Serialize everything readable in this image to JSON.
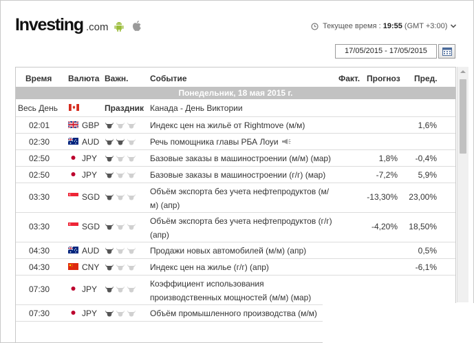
{
  "header": {
    "logo": "Investing",
    "logo_suffix": ".com",
    "time_label": "Текущее время :",
    "time_value": "19:55",
    "timezone": "(GMT +3:00)",
    "date_range": "17/05/2015 - 17/05/2015"
  },
  "columns": {
    "time": "Время",
    "currency": "Валюта",
    "importance": "Важн.",
    "event": "Событие",
    "actual": "Факт.",
    "forecast": "Прогноз",
    "previous": "Пред."
  },
  "day_header": "Понедельник, 18 мая 2015 г.",
  "holiday": {
    "time": "Весь День",
    "flag": "CA",
    "importance": "Праздник",
    "event": "Канада - День Виктории"
  },
  "rows": [
    {
      "time": "02:01",
      "flag": "GB",
      "currency": "GBP",
      "importance": 1,
      "event": "Индекс цен на жильё от Rightmove (м/м)",
      "actual": "",
      "forecast": "",
      "previous": "1,6%",
      "speech": false
    },
    {
      "time": "02:30",
      "flag": "AU",
      "currency": "AUD",
      "importance": 2,
      "event": "Речь помощника главы РБА Лоуи",
      "actual": "",
      "forecast": "",
      "previous": "",
      "speech": true
    },
    {
      "time": "02:50",
      "flag": "JP",
      "currency": "JPY",
      "importance": 1,
      "event": "Базовые заказы в машиностроении (м/м) (мар)",
      "actual": "",
      "forecast": "1,8%",
      "previous": "-0,4%",
      "speech": false
    },
    {
      "time": "02:50",
      "flag": "JP",
      "currency": "JPY",
      "importance": 1,
      "event": "Базовые заказы в машиностроении (г/г) (мар)",
      "actual": "",
      "forecast": "-7,2%",
      "previous": "5,9%",
      "speech": false
    },
    {
      "time": "03:30",
      "flag": "SG",
      "currency": "SGD",
      "importance": 1,
      "event": "Объём экспорта без учета нефтепродуктов (м/м) (апр)",
      "actual": "",
      "forecast": "-13,30%",
      "previous": "23,00%",
      "speech": false
    },
    {
      "time": "03:30",
      "flag": "SG",
      "currency": "SGD",
      "importance": 1,
      "event": "Объём экспорта без учета нефтепродуктов (г/г) (апр)",
      "actual": "",
      "forecast": "-4,20%",
      "previous": "18,50%",
      "speech": false
    },
    {
      "time": "04:30",
      "flag": "AU",
      "currency": "AUD",
      "importance": 1,
      "event": "Продажи новых автомобилей (м/м) (апр)",
      "actual": "",
      "forecast": "",
      "previous": "0,5%",
      "speech": false
    },
    {
      "time": "04:30",
      "flag": "CN",
      "currency": "CNY",
      "importance": 1,
      "event": "Индекс цен на жилье (г/г) (апр)",
      "actual": "",
      "forecast": "",
      "previous": "-6,1%",
      "speech": false
    },
    {
      "time": "07:30",
      "flag": "JP",
      "currency": "JPY",
      "importance": 1,
      "event": "Коэффициент использования производственных мощностей (м/м) (мар)",
      "actual": "",
      "forecast": "",
      "previous": "",
      "speech": false
    },
    {
      "time": "07:30",
      "flag": "JP",
      "currency": "JPY",
      "importance": 1,
      "event": "Объём промышленного производства (м/м)",
      "actual": "",
      "forecast": "",
      "previous": "",
      "speech": false
    }
  ],
  "colors": {
    "day_header_bg": "#c2c2c2",
    "bull_active": "#555555",
    "bull_inactive": "#d0d0d0",
    "border": "#dcdcdc"
  }
}
